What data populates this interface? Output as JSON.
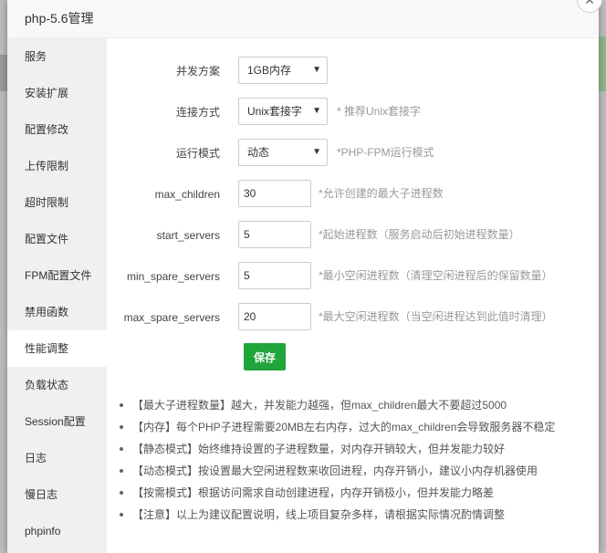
{
  "modal": {
    "title": "php-5.6管理"
  },
  "sidebar": {
    "items": [
      {
        "label": "服务"
      },
      {
        "label": "安装扩展"
      },
      {
        "label": "配置修改"
      },
      {
        "label": "上传限制"
      },
      {
        "label": "超时限制"
      },
      {
        "label": "配置文件"
      },
      {
        "label": "FPM配置文件"
      },
      {
        "label": "禁用函数"
      },
      {
        "label": "性能调整"
      },
      {
        "label": "负载状态"
      },
      {
        "label": "Session配置"
      },
      {
        "label": "日志"
      },
      {
        "label": "慢日志"
      },
      {
        "label": "phpinfo"
      }
    ],
    "active_index": 8
  },
  "form": {
    "concurrency": {
      "label": "并发方案",
      "value": "1GB内存"
    },
    "connection": {
      "label": "连接方式",
      "value": "Unix套接字",
      "hint": "* 推荐Unix套接字"
    },
    "run_mode": {
      "label": "运行模式",
      "value": "动态",
      "hint": "*PHP-FPM运行模式"
    },
    "max_children": {
      "label": "max_children",
      "value": "30",
      "hint": "*允许创建的最大子进程数"
    },
    "start_servers": {
      "label": "start_servers",
      "value": "5",
      "hint": "*起始进程数（服务启动后初始进程数量）"
    },
    "min_spare_servers": {
      "label": "min_spare_servers",
      "value": "5",
      "hint": "*最小空闲进程数（清理空闲进程后的保留数量）"
    },
    "max_spare_servers": {
      "label": "max_spare_servers",
      "value": "20",
      "hint": "*最大空闲进程数（当空闲进程达到此值时清理）"
    },
    "save_label": "保存"
  },
  "notes": [
    "【最大子进程数量】越大，并发能力越强，但max_children最大不要超过5000",
    "【内存】每个PHP子进程需要20MB左右内存，过大的max_children会导致服务器不稳定",
    "【静态模式】始终维持设置的子进程数量，对内存开销较大，但并发能力较好",
    "【动态模式】按设置最大空闲进程数来收回进程，内存开销小，建议小内存机器使用",
    "【按需模式】根据访问需求自动创建进程，内存开销极小，但并发能力略差",
    "【注意】以上为建议配置说明，线上项目复杂多样，请根据实际情况酌情调整"
  ],
  "colors": {
    "accent": "#20a53a",
    "sidebar_bg": "#f0f0f0",
    "active_bg": "#ffffff"
  },
  "icons": {
    "close": "close-icon",
    "dropdown": "chevron-down-icon"
  }
}
